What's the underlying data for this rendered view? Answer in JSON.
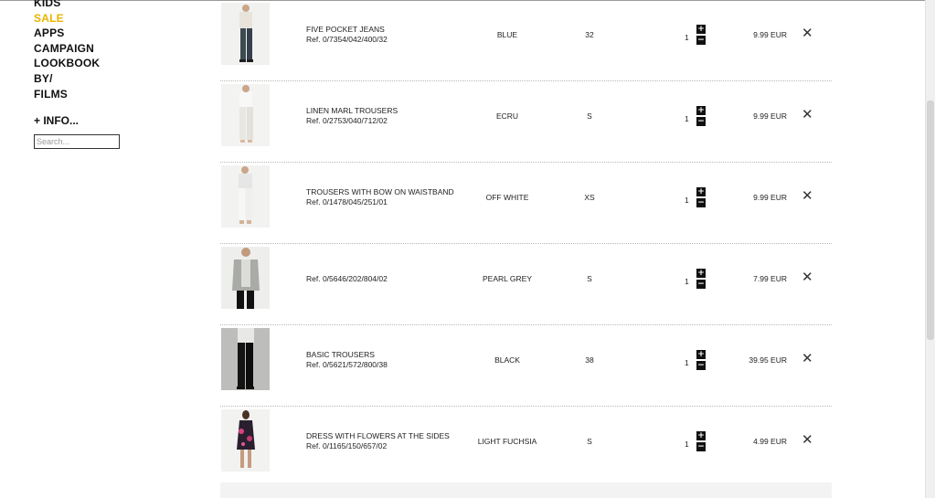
{
  "sidebar": {
    "nav": [
      "KIDS",
      "SALE",
      "APPS",
      "CAMPAIGN",
      "LOOKBOOK",
      "BY/",
      "FILMS"
    ],
    "info_label": "+ INFO...",
    "search_placeholder": "Search..."
  },
  "cart": {
    "items": [
      {
        "name": "FIVE POCKET JEANS",
        "ref": "Ref. 0/7354/042/400/32",
        "color": "BLUE",
        "size": "32",
        "qty": "1",
        "price": "9.99 EUR"
      },
      {
        "name": "LINEN MARL TROUSERS",
        "ref": "Ref. 0/2753/040/712/02",
        "color": "ECRU",
        "size": "S",
        "qty": "1",
        "price": "9.99 EUR"
      },
      {
        "name": "TROUSERS WITH BOW ON WAISTBAND",
        "ref": "Ref. 0/1478/045/251/01",
        "color": "OFF WHITE",
        "size": "XS",
        "qty": "1",
        "price": "9.99 EUR"
      },
      {
        "name": "",
        "ref": "Ref. 0/5646/202/804/02",
        "color": "PEARL GREY",
        "size": "S",
        "qty": "1",
        "price": "7.99 EUR"
      },
      {
        "name": "BASIC TROUSERS",
        "ref": "Ref. 0/5621/572/800/38",
        "color": "BLACK",
        "size": "38",
        "qty": "1",
        "price": "39.95 EUR"
      },
      {
        "name": "DRESS WITH FLOWERS AT THE SIDES",
        "ref": "Ref. 0/1165/150/657/02",
        "color": "LIGHT FUCHSIA",
        "size": "S",
        "qty": "1",
        "price": "4.99 EUR"
      }
    ],
    "plus_symbol": "+",
    "minus_symbol": "−",
    "remove_symbol": "✕"
  },
  "colors": {
    "accent_sale": "#e8b400",
    "text": "#222222",
    "qty_button": "#111111"
  }
}
